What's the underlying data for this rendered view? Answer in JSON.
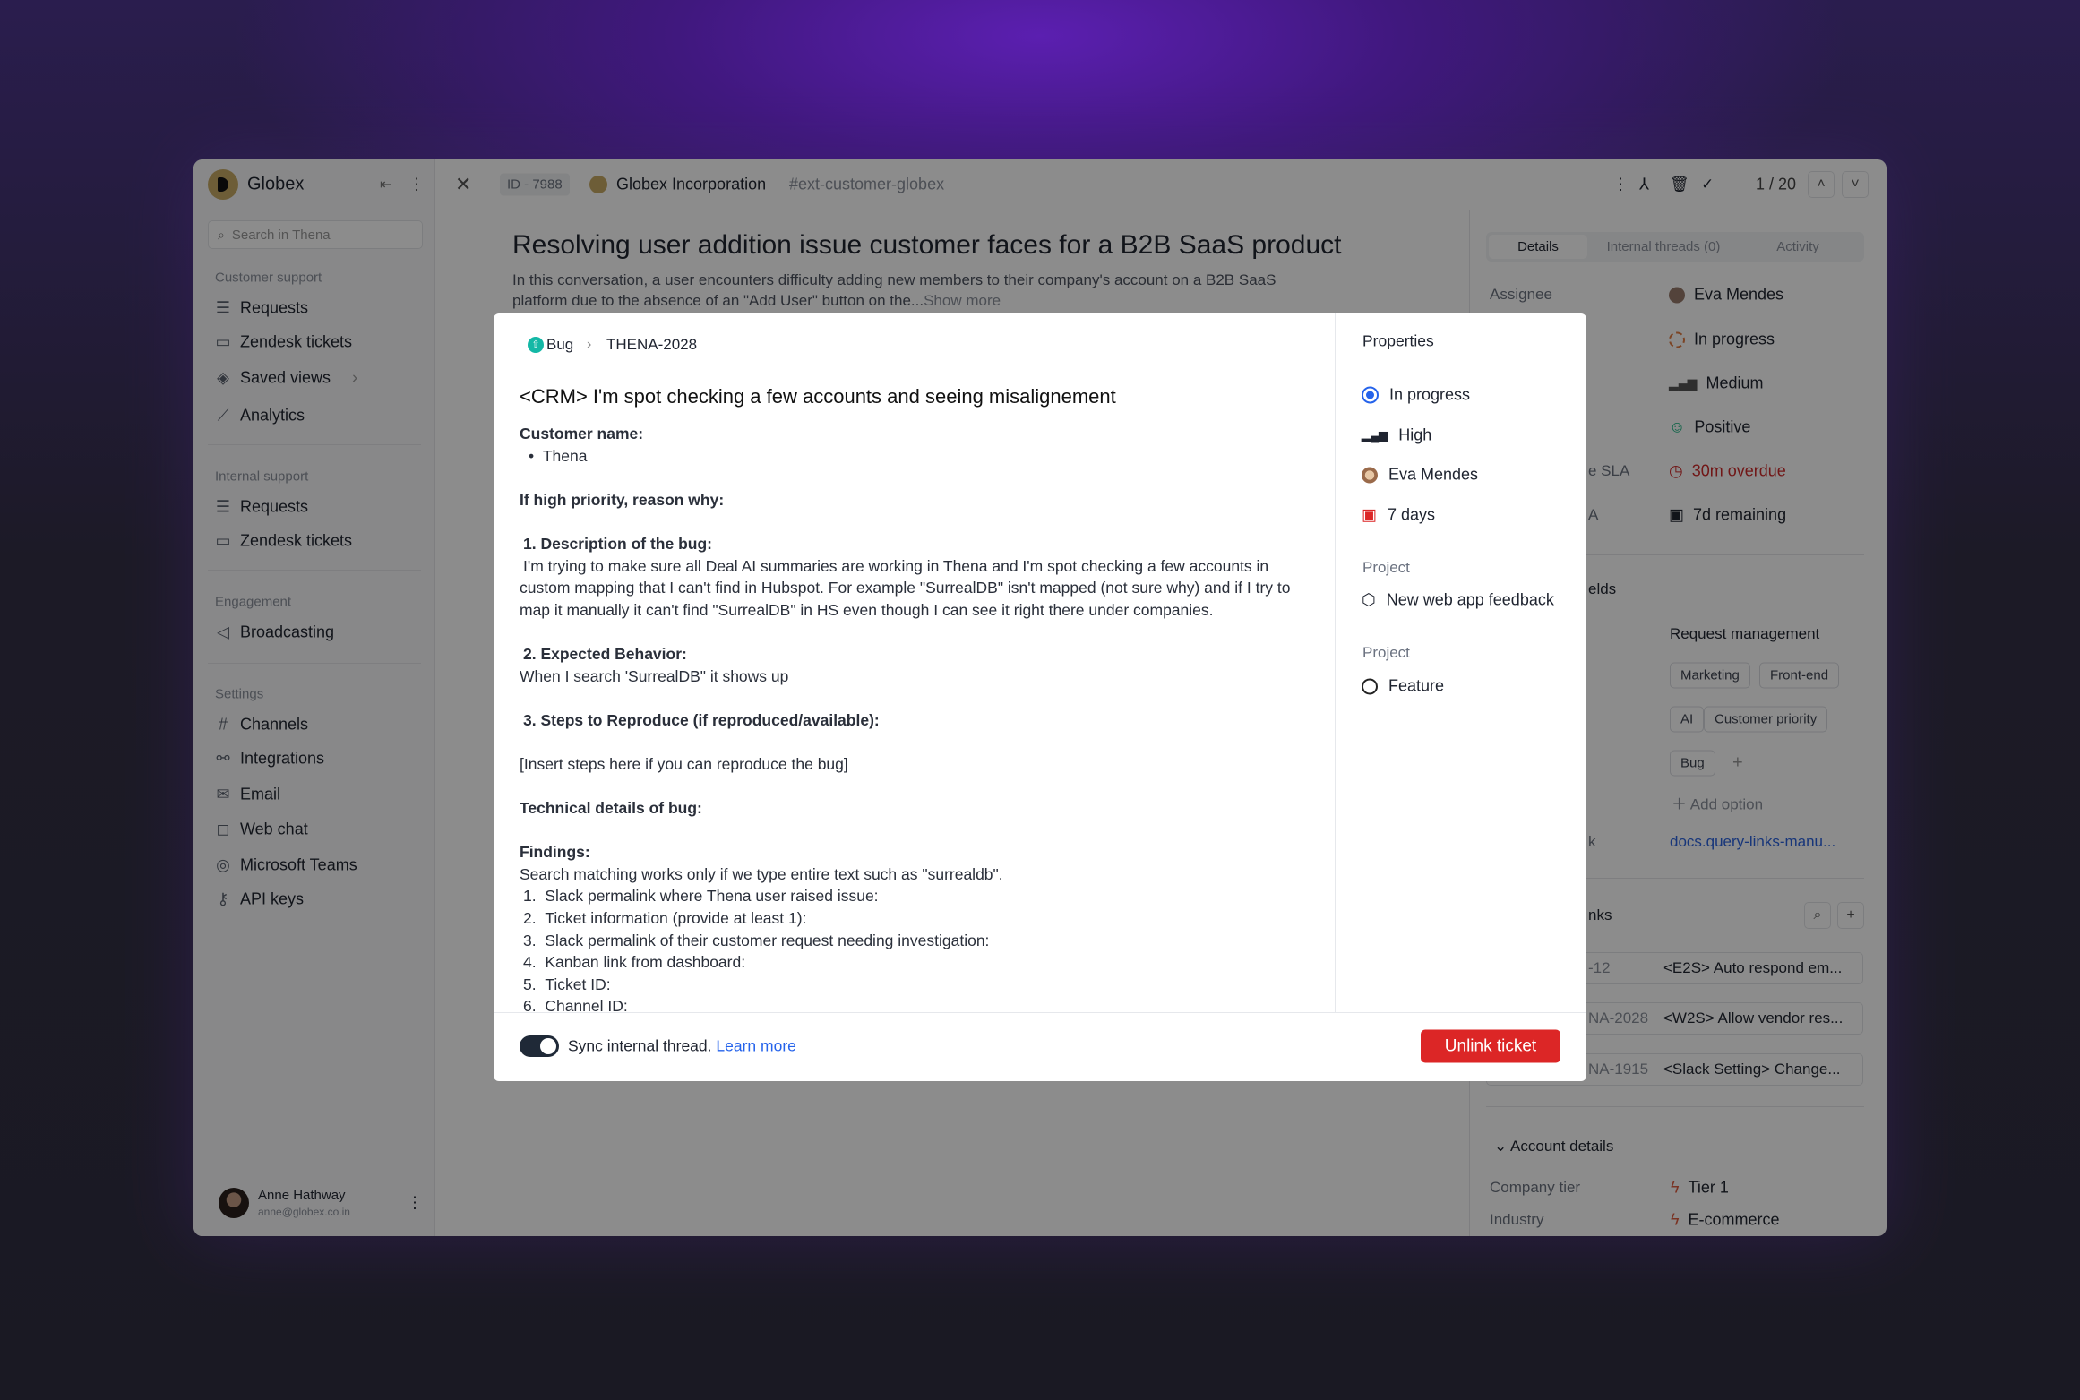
{
  "sidebar": {
    "org": "Globex",
    "search_placeholder": "Search in Thena",
    "sections": [
      {
        "title": "Customer support",
        "items": [
          "Requests",
          "Zendesk tickets",
          "Saved views",
          "Analytics"
        ]
      },
      {
        "title": "Internal support",
        "items": [
          "Requests",
          "Zendesk tickets"
        ]
      },
      {
        "title": "Engagement",
        "items": [
          "Broadcasting"
        ]
      },
      {
        "title": "Settings",
        "items": [
          "Channels",
          "Integrations",
          "Email",
          "Web chat",
          "Microsoft Teams",
          "API keys"
        ]
      }
    ],
    "user": {
      "name": "Anne Hathway",
      "email": "anne@globex.co.in"
    }
  },
  "header": {
    "id": "ID - 7988",
    "company": "Globex Incorporation",
    "channel": "#ext-customer-globex",
    "pager": "1 / 20"
  },
  "main": {
    "title": "Resolving user addition issue customer faces for a B2B SaaS product",
    "desc1": "In this conversation, a user encounters difficulty adding new members to their company's account on a B2B SaaS",
    "desc2": "platform due to the absence of an \"Add User\" button on the...",
    "show_more": "Show more"
  },
  "details": {
    "tabs": [
      "Details",
      "Internal threads (0)",
      "Activity"
    ],
    "assignee_label": "Assignee",
    "assignee": "Eva Mendes",
    "status": "In progress",
    "priority": "Medium",
    "sentiment": "Positive",
    "sla_label_partial": "e SLA",
    "sla": "30m overdue",
    "sla2_label_partial": "A",
    "sla2": "7d remaining",
    "fields_partial": "elds",
    "request_type": "Request management",
    "tags": [
      "Marketing",
      "Front-end",
      "AI",
      "Customer priority",
      "Bug"
    ],
    "add_option": "Add option",
    "link_label_partial": "k",
    "link": "docs.query-links-manu...",
    "links_partial": "nks",
    "linked": [
      {
        "id": "-12",
        "title": "<E2S> Auto respond em..."
      },
      {
        "id": "NA-2028",
        "title": "<W2S> Allow vendor res..."
      },
      {
        "id": "NA-1915",
        "title": "<Slack Setting> Change..."
      }
    ],
    "account_title": "Account details",
    "company_tier_label": "Company tier",
    "company_tier": "Tier 1",
    "industry_label": "Industry",
    "industry": "E-commerce"
  },
  "modal": {
    "type": "Bug",
    "ticket": "THENA-2028",
    "title": "<CRM> I'm spot checking a few accounts and seeing misalignement",
    "customer_label": "Customer name:",
    "customer": "Thena",
    "priority_reason": "If high priority, reason why:",
    "desc_h": "1. Description of the bug:",
    "desc": "I'm trying to make sure all Deal AI summaries are working in Thena and I'm spot checking a few accounts in custom mapping that I can't find in Hubspot. For example \"SurrealDB\" isn't mapped (not sure why) and if I try to map it manually it can't find \"SurrealDB\" in HS even though I can see it right there under companies.",
    "expected_h": "2. Expected Behavior:",
    "expected": "When I search 'SurrealDB\" it shows up",
    "steps_h": "3. Steps to Reproduce (if reproduced/available):",
    "steps": "[Insert steps here if you can reproduce the bug]",
    "tech_h": "Technical details of bug:",
    "findings_h": "Findings:",
    "findings": "Search matching works only if we type entire text such as \"surrealdb\".",
    "list": [
      "Slack permalink where Thena user raised issue:",
      "Ticket information (provide at least 1):",
      "Slack permalink of their customer request needing investigation:",
      "Kanban link from dashboard:",
      "Ticket ID:",
      "Channel ID:"
    ],
    "props": {
      "title": "Properties",
      "status": "In progress",
      "priority": "High",
      "assignee": "Eva Mendes",
      "due": "7 days",
      "project_label": "Project",
      "project": "New web app feedback",
      "project2_label": "Project",
      "project2": "Feature"
    },
    "sync": "Sync internal thread.",
    "sync_on": true,
    "learn_more": "Learn more",
    "unlink": "Unlink ticket"
  },
  "colors": {
    "accent": "#2563eb",
    "danger": "#dc2626",
    "success": "#10b981"
  }
}
